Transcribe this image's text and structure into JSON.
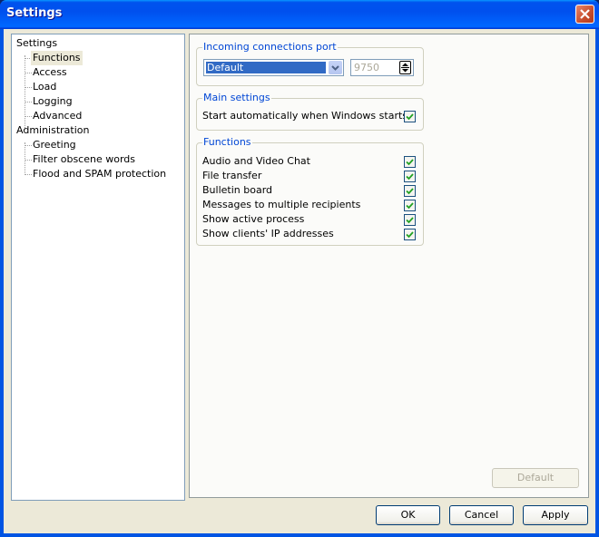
{
  "window": {
    "title": "Settings"
  },
  "tree": {
    "items": [
      {
        "label": "Settings",
        "level": 0
      },
      {
        "label": "Functions",
        "level": 1,
        "selected": true
      },
      {
        "label": "Access",
        "level": 1
      },
      {
        "label": "Load",
        "level": 1
      },
      {
        "label": "Logging",
        "level": 1
      },
      {
        "label": "Advanced",
        "level": 1
      },
      {
        "label": "Administration",
        "level": 0
      },
      {
        "label": "Greeting",
        "level": 1
      },
      {
        "label": "Filter obscene words",
        "level": 1
      },
      {
        "label": "Flood and SPAM protection",
        "level": 1
      }
    ]
  },
  "port_group": {
    "label": "Incoming connections port",
    "combo_value": "Default",
    "port_value": "9750"
  },
  "main_group": {
    "label": "Main settings",
    "items": [
      {
        "label": "Start automatically when Windows starts",
        "checked": true
      }
    ]
  },
  "functions_group": {
    "label": "Functions",
    "items": [
      {
        "label": "Audio and Video Chat",
        "checked": true
      },
      {
        "label": "File transfer",
        "checked": true
      },
      {
        "label": "Bulletin board",
        "checked": true
      },
      {
        "label": "Messages to multiple recipients",
        "checked": true
      },
      {
        "label": "Show active process",
        "checked": true
      },
      {
        "label": "Show clients' IP addresses",
        "checked": true
      }
    ]
  },
  "buttons": {
    "default": "Default",
    "ok": "OK",
    "cancel": "Cancel",
    "apply": "Apply"
  },
  "colors": {
    "accent": "#316ac5",
    "group_label": "#0046d5",
    "check": "#21a121"
  }
}
